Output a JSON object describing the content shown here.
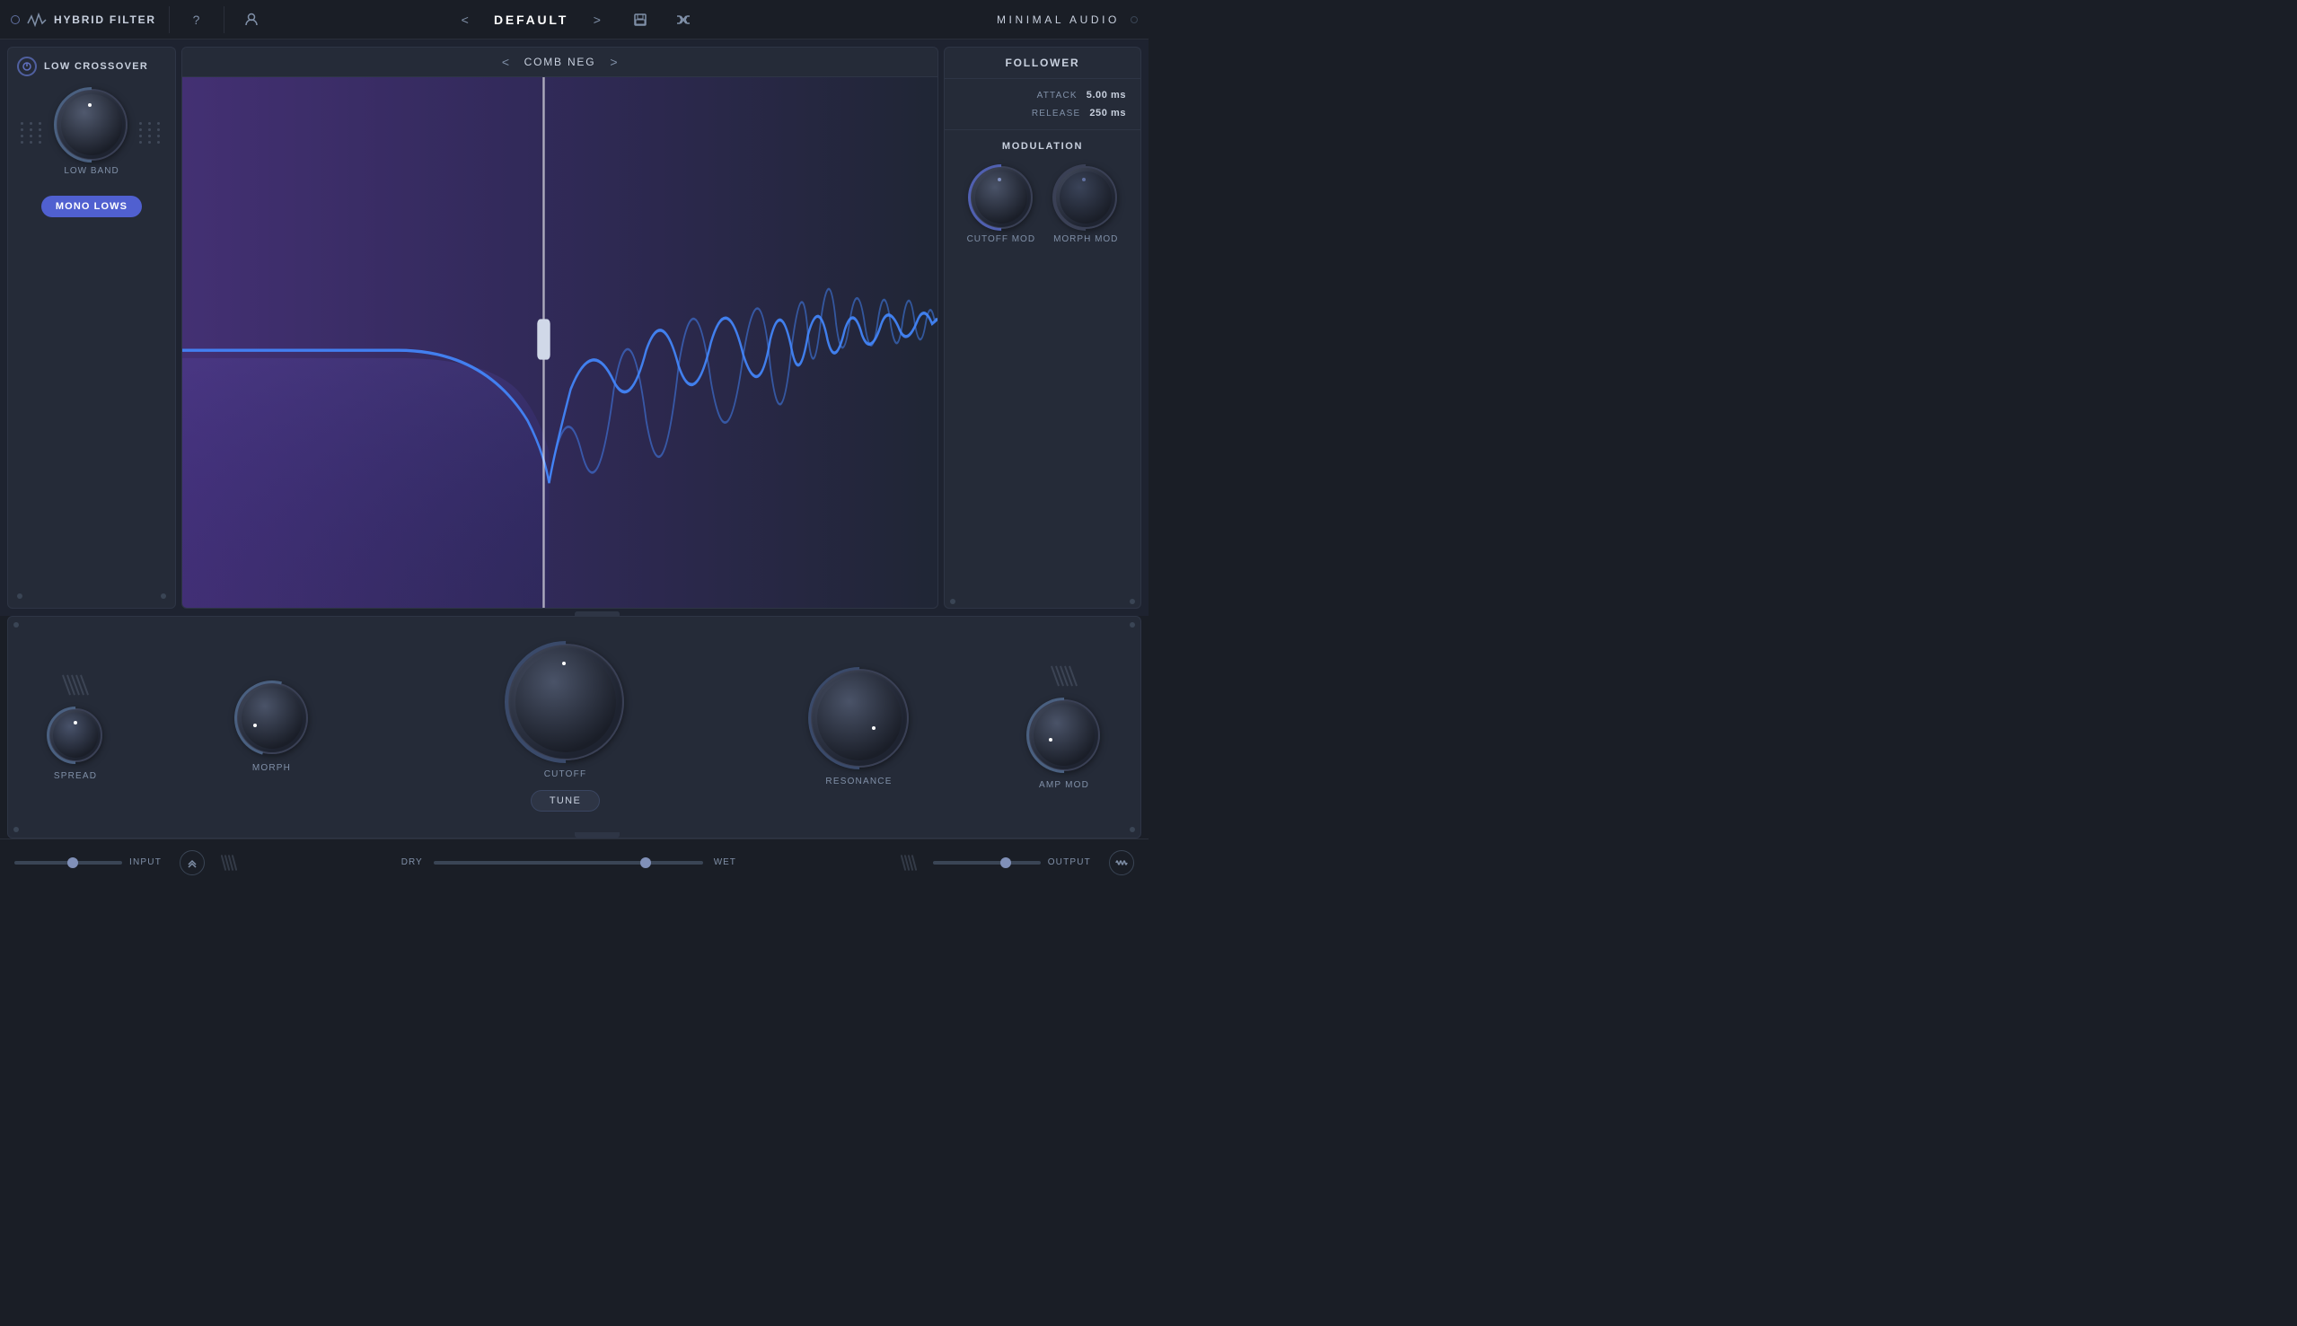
{
  "topbar": {
    "title": "HYBRID FILTER",
    "preset": "DEFAULT",
    "brand": "MINIMAL AUDIO",
    "help_label": "?",
    "prev_label": "<",
    "next_label": ">"
  },
  "left_panel": {
    "title": "LOW CROSSOVER",
    "knob_label": "LOW BAND",
    "mono_btn": "MONO LOWS"
  },
  "center_panel": {
    "filter_name": "COMB NEG",
    "prev": "<",
    "next": ">"
  },
  "right_panel": {
    "title": "FOLLOWER",
    "attack_label": "ATTACK",
    "attack_value": "5.00 ms",
    "release_label": "RELEASE",
    "release_value": "250 ms",
    "modulation_title": "MODULATION",
    "cutoff_mod_label": "CUTOFF MOD",
    "morph_mod_label": "MORPH MOD"
  },
  "bottom": {
    "spread_label": "SPREAD",
    "morph_label": "MORPH",
    "cutoff_label": "CUTOFF",
    "resonance_label": "RESONANCE",
    "amp_mod_label": "AMP MOD",
    "tune_btn": "TUNE"
  },
  "footer": {
    "input_label": "INPUT",
    "dry_label": "DRY",
    "wet_label": "WET",
    "output_label": "OUTPUT"
  }
}
